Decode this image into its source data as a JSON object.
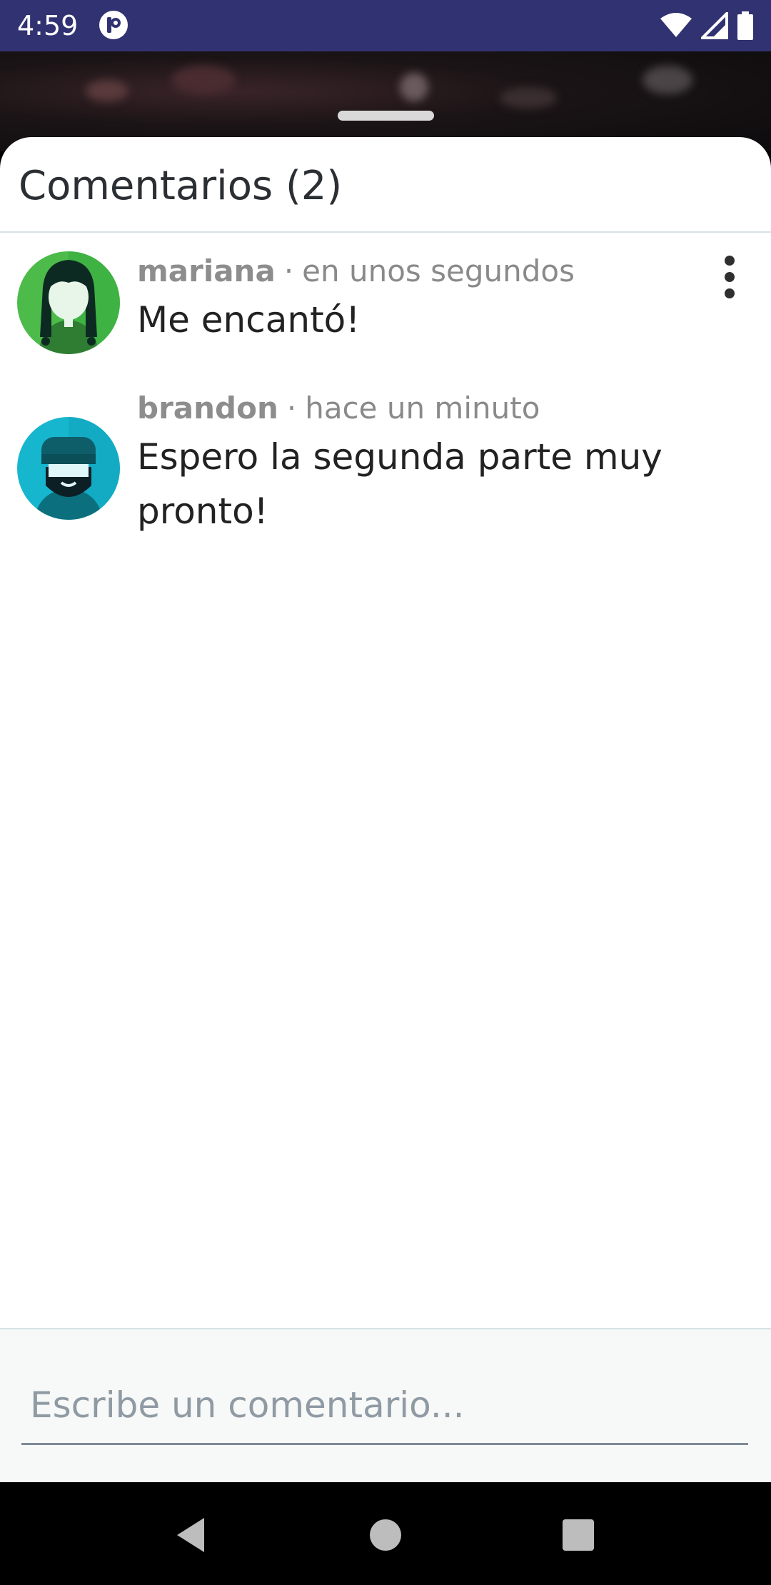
{
  "status_bar": {
    "time": "4:59",
    "app_icon": "notification-app-icon",
    "icons": [
      "wifi-icon",
      "cell-signal-icon",
      "battery-icon"
    ]
  },
  "sheet": {
    "title": "Comentarios (2)"
  },
  "comments": [
    {
      "author": "mariana",
      "separator": "·",
      "time": "en unos segundos",
      "text": "Me encantó!",
      "avatar": "female-avatar-icon",
      "avatar_color": "#4cbb4a"
    },
    {
      "author": "brandon",
      "separator": "·",
      "time": "hace un minuto",
      "text": "Espero la segunda parte muy pronto!",
      "avatar": "bearded-man-avatar-icon",
      "avatar_color": "#17b6cf"
    }
  ],
  "composer": {
    "placeholder": "Escribe un comentario..."
  },
  "nav": {
    "back": "back-icon",
    "home": "home-icon",
    "recents": "recents-icon"
  },
  "colors": {
    "status_bar": "#313272",
    "accent_green": "#4cbb4a",
    "accent_cyan": "#17b6cf"
  }
}
